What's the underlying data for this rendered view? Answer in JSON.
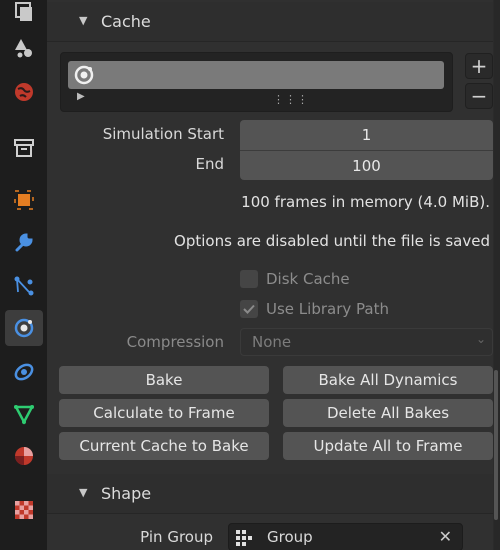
{
  "tabs": [
    {
      "name": "tab-view-layer",
      "icon": "view-layer-icon"
    },
    {
      "name": "tab-scene",
      "icon": "scene-icon"
    },
    {
      "name": "tab-world",
      "icon": "world-icon"
    },
    {
      "name": "tab-collection",
      "icon": "collection-icon"
    },
    {
      "name": "tab-object",
      "icon": "object-icon"
    },
    {
      "name": "tab-modifiers",
      "icon": "wrench-icon"
    },
    {
      "name": "tab-particles",
      "icon": "particles-icon"
    },
    {
      "name": "tab-physics",
      "icon": "physics-icon",
      "active": true
    },
    {
      "name": "tab-constraints",
      "icon": "constraint-icon"
    },
    {
      "name": "tab-data",
      "icon": "mesh-data-icon"
    },
    {
      "name": "tab-material",
      "icon": "material-icon"
    },
    {
      "name": "tab-texture",
      "icon": "texture-icon"
    }
  ],
  "cache_section": {
    "title": "Cache",
    "list_item_icon": "physics-icon",
    "add_label": "+",
    "remove_label": "−",
    "simulation_start_label": "Simulation Start",
    "simulation_start_value": "1",
    "end_label": "End",
    "end_value": "100",
    "memory_info": "100 frames in memory (4.0 MiB).",
    "disabled_info": "Options are disabled until the file is saved",
    "disk_cache_label": "Disk Cache",
    "disk_cache_checked": false,
    "use_library_path_label": "Use Library Path",
    "use_library_path_checked": true,
    "compression_label": "Compression",
    "compression_value": "None",
    "buttons": {
      "bake": "Bake",
      "bake_all_dynamics": "Bake All Dynamics",
      "calculate_to_frame": "Calculate to Frame",
      "delete_all_bakes": "Delete All Bakes",
      "current_cache_to_bake": "Current Cache to Bake",
      "update_all_to_frame": "Update All to Frame"
    }
  },
  "shape_section": {
    "title": "Shape",
    "pin_group_label": "Pin Group",
    "pin_group_value": "Group",
    "clear_label": "✕"
  }
}
